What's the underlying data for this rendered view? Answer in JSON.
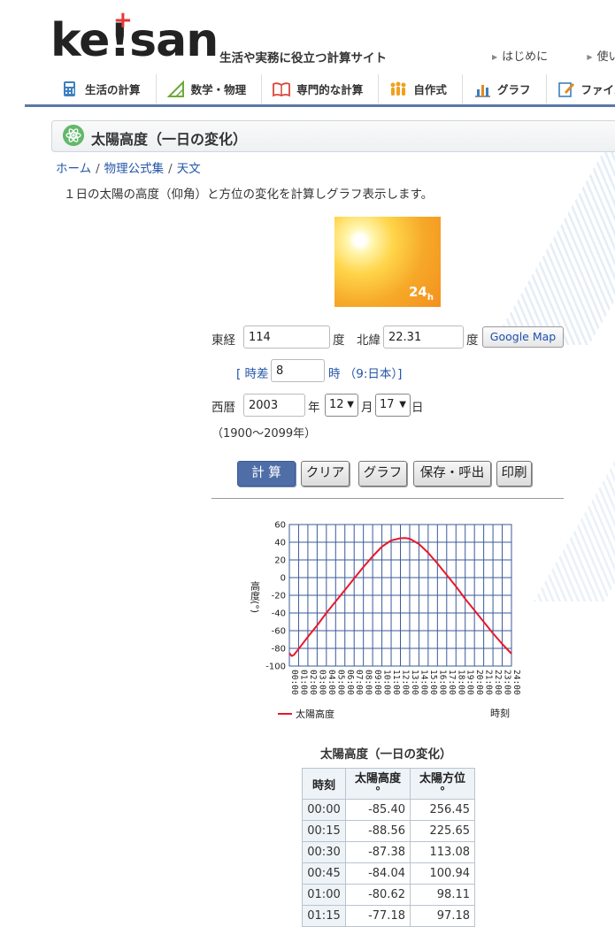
{
  "header": {
    "logo_text": "ke!san",
    "tagline": "生活や実務に役立つ計算サイト",
    "top_links": [
      "はじめに",
      "使い方"
    ]
  },
  "nav": {
    "items": [
      "生活の計算",
      "数学・物理",
      "専門的な計算",
      "自作式",
      "グラフ",
      "ファイル"
    ]
  },
  "page": {
    "title": "太陽高度（一日の変化）",
    "breadcrumb": [
      "ホーム",
      "物理公式集",
      "天文"
    ],
    "description": "１日の太陽の高度（仰角）と方位の変化を計算しグラフ表示します。",
    "hero_text": "24",
    "hero_sub": "h"
  },
  "form": {
    "lon_label": "東経",
    "lon_value": "114",
    "deg_unit": "度",
    "lat_label": "北緯",
    "lat_value": "22.31",
    "google_map": "Google Map",
    "tz_open": "[ 時差",
    "tz_value": "8",
    "tz_close": "時 （9:日本）]",
    "year_label": "西暦",
    "year_value": "2003",
    "year_unit": "年",
    "month_value": "12",
    "month_unit": "月",
    "day_value": "17",
    "day_unit": "日",
    "range_note": "（1900～2099年）"
  },
  "buttons": {
    "calc": "計 算",
    "clear": "クリア",
    "graph": "グラフ",
    "save": "保存・呼出",
    "print": "印刷"
  },
  "chart_data": {
    "type": "line",
    "ylabel": "高度(°)",
    "xlabel": "時刻",
    "ylim": [
      -100,
      60
    ],
    "yticks": [
      60,
      40,
      20,
      0,
      -20,
      -40,
      -60,
      -80,
      -100
    ],
    "x_tick_labels": [
      "00:00",
      "01:00",
      "02:00",
      "03:00",
      "04:00",
      "05:00",
      "06:00",
      "07:00",
      "08:00",
      "09:00",
      "10:00",
      "11:00",
      "12:00",
      "13:00",
      "14:00",
      "15:00",
      "16:00",
      "17:00",
      "18:00",
      "19:00",
      "20:00",
      "21:00",
      "22:00",
      "23:00",
      "24:00"
    ],
    "grid": true,
    "legend_position": "bottom-left",
    "line_color": "#e8192c",
    "series": [
      {
        "name": "太陽高度",
        "x": [
          0,
          0.25,
          0.5,
          0.75,
          1,
          1.25,
          2,
          3,
          4,
          5,
          6,
          7,
          8,
          9,
          10,
          11,
          12,
          12.5,
          13,
          14,
          15,
          16,
          17,
          18,
          19,
          20,
          21,
          22,
          23,
          24
        ],
        "values": [
          -85.4,
          -88.56,
          -87.38,
          -84.04,
          -80.62,
          -77.18,
          -67,
          -54,
          -40,
          -27,
          -14,
          -1,
          12,
          24,
          35,
          42,
          44.5,
          44.7,
          44,
          38,
          28,
          16,
          3,
          -10,
          -24,
          -37,
          -50,
          -63,
          -75,
          -86
        ]
      }
    ]
  },
  "table": {
    "title": "太陽高度（一日の変化）",
    "headers": [
      "時刻",
      "太陽高度 °",
      "太陽方位 °"
    ],
    "rows": [
      [
        "00:00",
        "-85.40",
        "256.45"
      ],
      [
        "00:15",
        "-88.56",
        "225.65"
      ],
      [
        "00:30",
        "-87.38",
        "113.08"
      ],
      [
        "00:45",
        "-84.04",
        "100.94"
      ],
      [
        "01:00",
        "-80.62",
        "98.11"
      ],
      [
        "01:15",
        "-77.18",
        "97.18"
      ]
    ]
  }
}
